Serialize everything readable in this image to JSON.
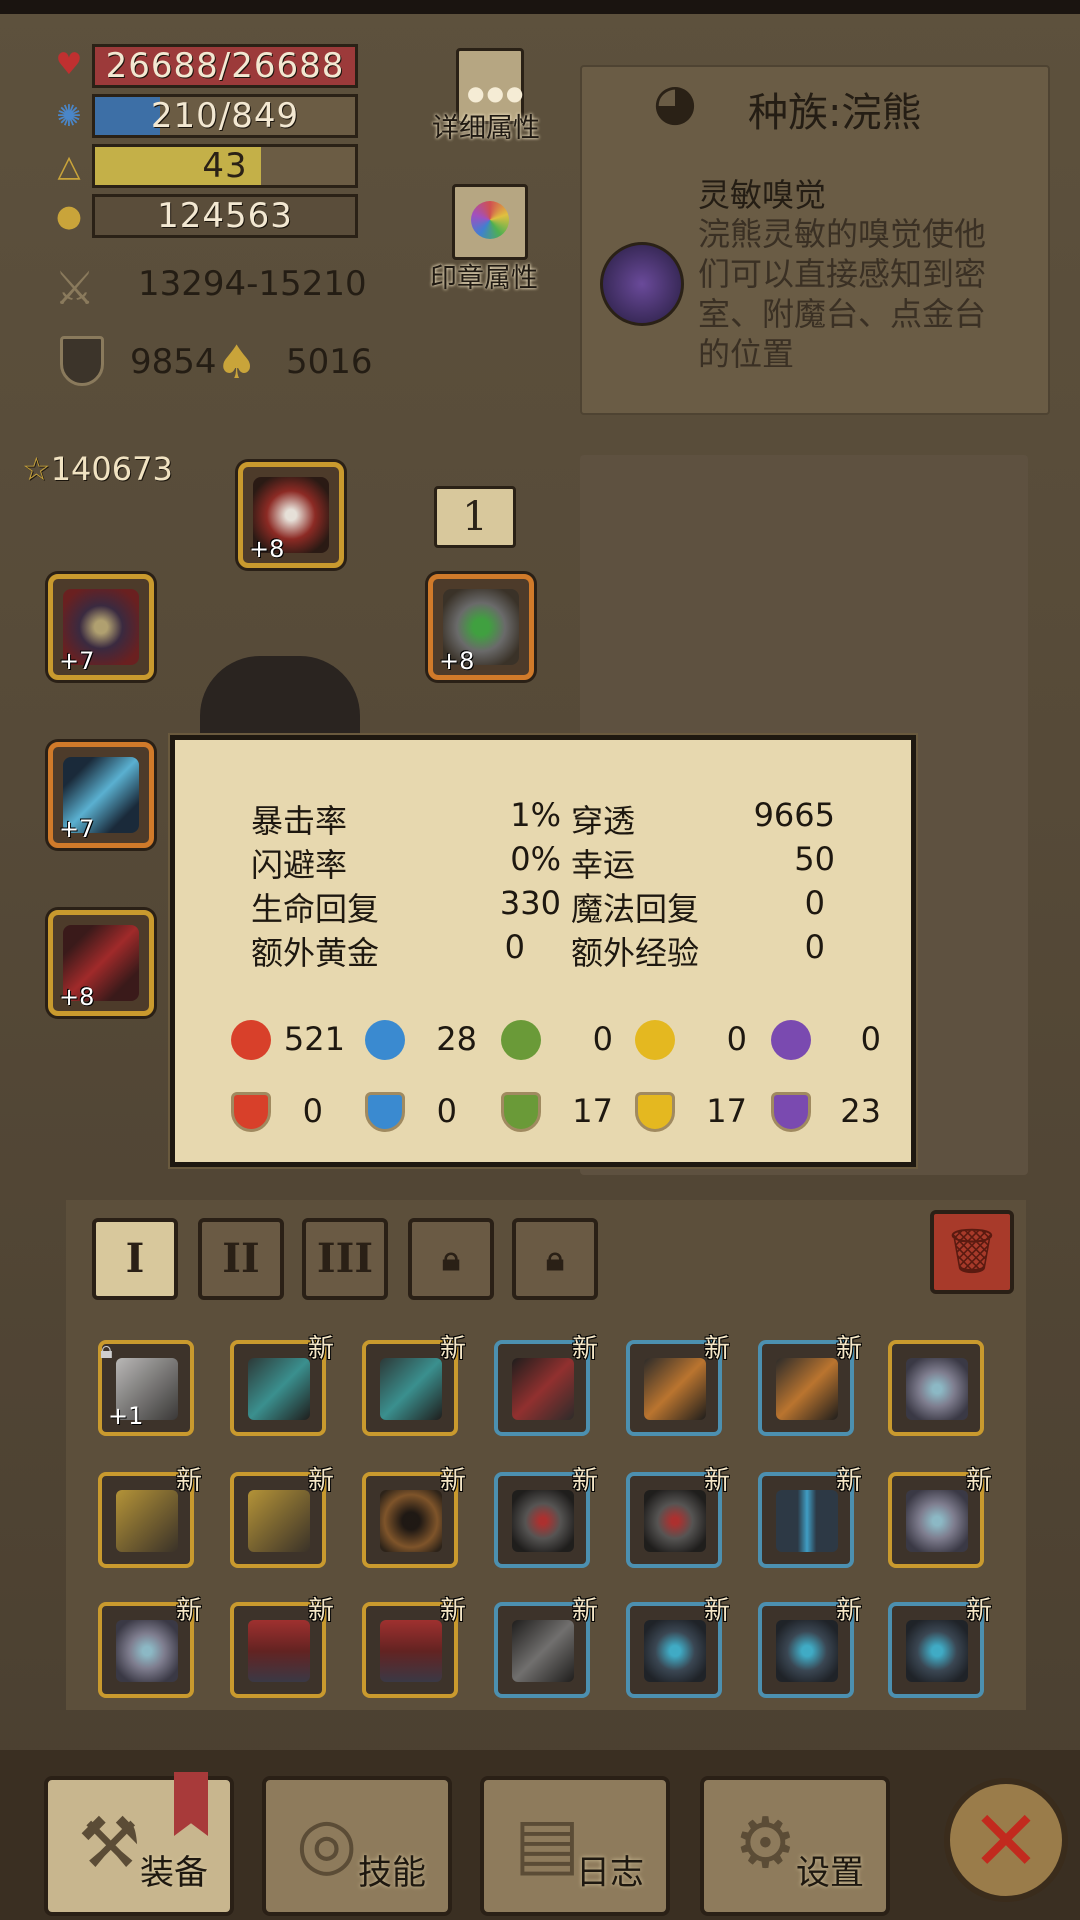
{
  "stats": {
    "hp": "26688/26688",
    "mp": "210/849",
    "level": "43",
    "gold": "124563",
    "attack": "13294-15210",
    "defense": "9854",
    "magic_power": "5016",
    "hp_fill": 1.0,
    "mp_fill": 0.25,
    "exp_fill": 0.64
  },
  "side_buttons": {
    "detail_attr": "详细属性",
    "seal_attr": "印章属性"
  },
  "race": {
    "title": "种族:浣熊",
    "skill_name": "灵敏嗅觉",
    "skill_desc_1": "浣熊灵敏的嗅觉使他",
    "skill_desc_2": "们可以直接感知到密",
    "skill_desc_3": "室、附魔台、点金台",
    "skill_desc_4": "的位置"
  },
  "equipment": {
    "score": "140673",
    "page_num": "1",
    "helmet_plus": "+8",
    "ring_plus": "+7",
    "amulet_plus": "+8",
    "weapon_plus": "+7",
    "glove_plus": "+8"
  },
  "tooltip": {
    "crit_label": "暴击率",
    "crit_value": "1%",
    "pierce_label": "穿透",
    "pierce_value": "9665",
    "dodge_label": "闪避率",
    "dodge_value": "0%",
    "luck_label": "幸运",
    "luck_value": "50",
    "hp_regen_label": "生命回复",
    "hp_regen_value": "330",
    "mp_regen_label": "魔法回复",
    "mp_regen_value": "0",
    "extra_gold_label": "额外黄金",
    "extra_gold_value": "0",
    "extra_exp_label": "额外经验",
    "extra_exp_value": "0",
    "attack_elements": [
      "521",
      "28",
      "0",
      "0",
      "0"
    ],
    "resist_elements": [
      "0",
      "0",
      "17",
      "17",
      "23"
    ],
    "element_colors": [
      "#d8402a",
      "#3a8ad0",
      "#6a9a38",
      "#e4b820",
      "#7a4ab0"
    ]
  },
  "bag": {
    "tabs": [
      "I",
      "II",
      "III"
    ],
    "locked_tabs": 2,
    "new_label": "新",
    "locked_item_plus": "+1"
  },
  "nav": {
    "equip": "装备",
    "skills": "技能",
    "journal": "日志",
    "settings": "设置"
  }
}
